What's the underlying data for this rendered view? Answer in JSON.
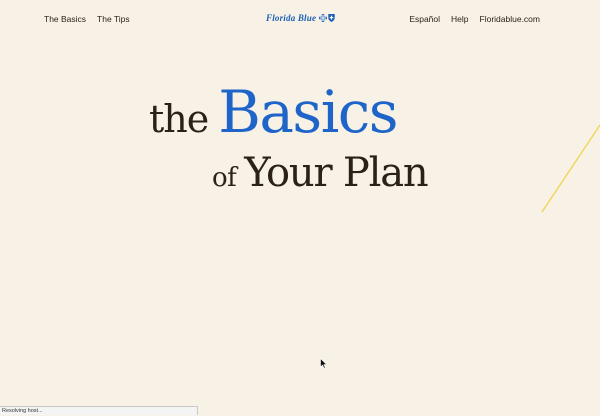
{
  "nav": {
    "left": [
      "The Basics",
      "The Tips"
    ],
    "right": [
      "Español",
      "Help",
      "Floridablue.com"
    ]
  },
  "logo": {
    "text": "Florida Blue"
  },
  "hero": {
    "word1": "the",
    "word2": "Basics",
    "word3": "of",
    "word4": "Your Plan"
  },
  "status_bar": {
    "text": "Resolving host..."
  },
  "colors": {
    "background": "#f8f2e6",
    "accent_blue": "#1f64c8",
    "text_dark": "#2b2118",
    "deco_yellow": "#f2d250"
  }
}
